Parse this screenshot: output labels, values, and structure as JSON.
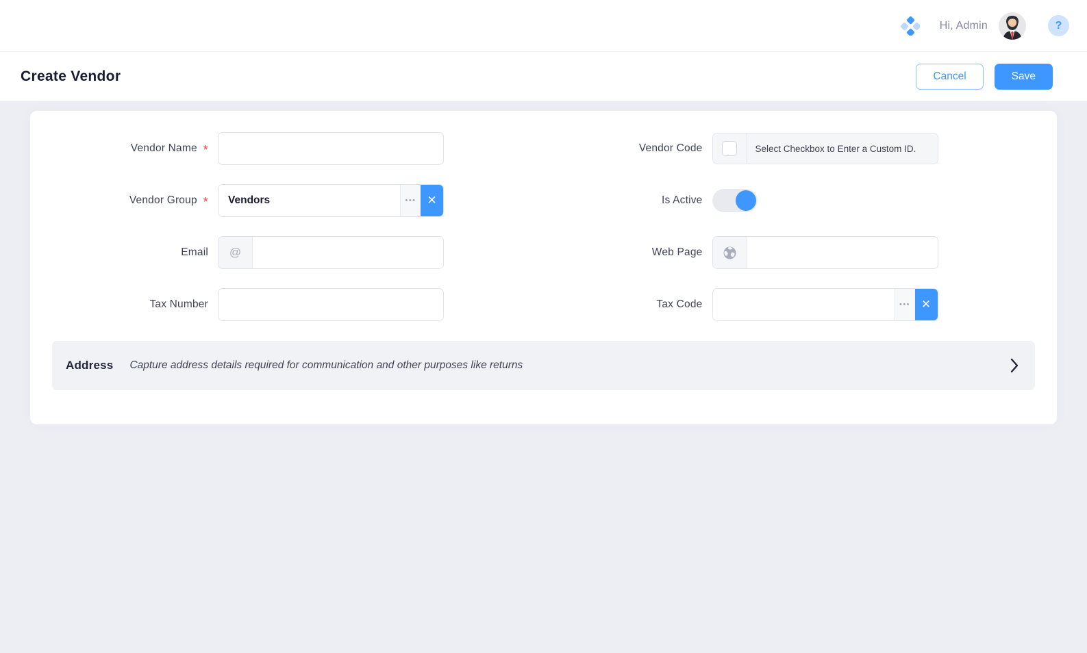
{
  "topbar": {
    "greeting": "Hi, Admin",
    "help_glyph": "?"
  },
  "header": {
    "title": "Create Vendor",
    "cancel_label": "Cancel",
    "save_label": "Save"
  },
  "form": {
    "required_marker": "*",
    "vendor_name": {
      "label": "Vendor Name",
      "value": ""
    },
    "vendor_code": {
      "label": "Vendor Code",
      "hint": "Select Checkbox to Enter a Custom ID.",
      "checked": false
    },
    "vendor_group": {
      "label": "Vendor Group",
      "value": "Vendors"
    },
    "is_active": {
      "label": "Is Active",
      "on": true
    },
    "email": {
      "label": "Email",
      "addon_glyph": "@",
      "value": ""
    },
    "web_page": {
      "label": "Web Page",
      "value": ""
    },
    "tax_number": {
      "label": "Tax Number",
      "value": ""
    },
    "tax_code": {
      "label": "Tax Code",
      "value": ""
    }
  },
  "glyphs": {
    "more_dots": "•••",
    "clear": "✕"
  },
  "address_section": {
    "title": "Address",
    "subtitle": "Capture address details required for communication and other purposes like returns"
  },
  "colors": {
    "accent": "#3E97FF",
    "required_red": "#E8453C",
    "page_bg": "#EDEEF4"
  }
}
